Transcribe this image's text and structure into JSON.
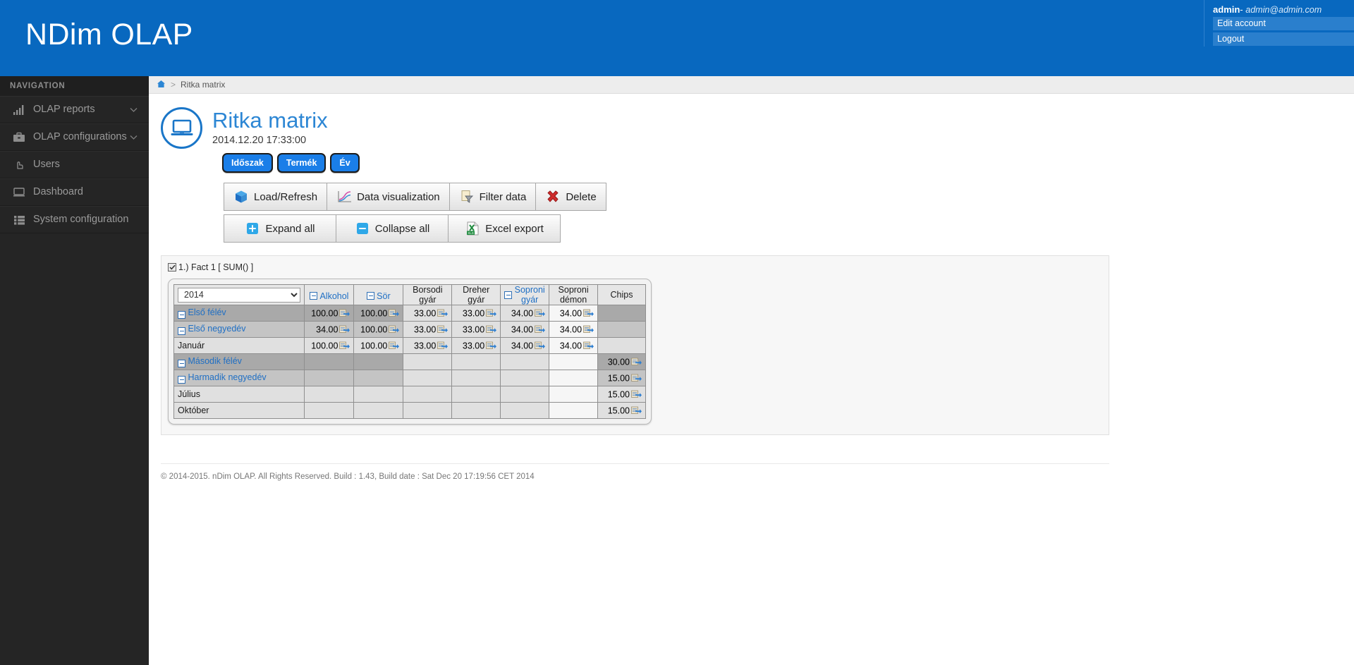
{
  "header": {
    "brand": "NDim OLAP",
    "account": {
      "user": "admin",
      "dash": "-",
      "email": "admin@admin.com",
      "menu": [
        {
          "label": "Edit account",
          "icon": "edit-account"
        },
        {
          "label": "Logout",
          "icon": "logout"
        }
      ]
    }
  },
  "sidebar": {
    "title": "NAVIGATION",
    "items": [
      {
        "label": "OLAP reports",
        "icon": "bar-chart-icon",
        "chevron": true
      },
      {
        "label": "OLAP configurations",
        "icon": "briefcase-icon",
        "chevron": true
      },
      {
        "label": "Users",
        "icon": "hand-pointer-icon",
        "chevron": false
      },
      {
        "label": "Dashboard",
        "icon": "monitor-icon",
        "chevron": false
      },
      {
        "label": "System configuration",
        "icon": "list-icon",
        "chevron": false
      }
    ]
  },
  "breadcrumb": {
    "home_icon": "home-icon",
    "separator": ">",
    "current": "Ritka matrix"
  },
  "page": {
    "icon": "monitor-circle-icon",
    "title": "Ritka matrix",
    "timestamp": "2014.12.20 17:33:00",
    "dimension_pills": [
      "Időszak",
      "Termék",
      "Év"
    ]
  },
  "toolbar": {
    "row1": [
      {
        "label": "Load/Refresh",
        "icon": "cube-icon"
      },
      {
        "label": "Data visualization",
        "icon": "line-chart-icon"
      },
      {
        "label": "Filter data",
        "icon": "funnel-icon"
      },
      {
        "label": "Delete",
        "icon": "red-x-icon"
      }
    ],
    "row2": [
      {
        "label": "Expand all",
        "icon": "plus-box-icon"
      },
      {
        "label": "Collapse all",
        "icon": "minus-box-icon"
      },
      {
        "label": "Excel export",
        "icon": "xls-icon"
      }
    ]
  },
  "result": {
    "fact_checkbox_checked": true,
    "fact_label": "1.) Fact 1 [ SUM() ]",
    "year_select": {
      "value": "2014",
      "options": [
        "2014"
      ]
    },
    "columns": [
      {
        "label": "Alkohol",
        "collapsible": true,
        "link": true,
        "style": "sel"
      },
      {
        "label": "Sör",
        "collapsible": true,
        "link": true,
        "style": "semi"
      },
      {
        "label": "Borsodi gyár",
        "collapsible": false,
        "link": false,
        "style": "lite"
      },
      {
        "label": "Dreher gyár",
        "collapsible": false,
        "link": false,
        "style": "lite"
      },
      {
        "label": "Soproni gyár",
        "collapsible": true,
        "link": true,
        "style": "lite"
      },
      {
        "label": "Soproni démon",
        "collapsible": false,
        "link": false,
        "style": "white"
      },
      {
        "label": "Chips",
        "collapsible": false,
        "link": false,
        "style": "sel"
      }
    ],
    "rows": [
      {
        "label": "Első félév",
        "collapsible": true,
        "link": true,
        "indent": 0,
        "style": "sel",
        "cells": [
          "100.00",
          "100.00",
          "33.00",
          "33.00",
          "34.00",
          "34.00",
          ""
        ]
      },
      {
        "label": "Első negyedév",
        "collapsible": true,
        "link": true,
        "indent": 1,
        "style": "semi",
        "cells": [
          "34.00",
          "100.00",
          "33.00",
          "33.00",
          "34.00",
          "34.00",
          ""
        ]
      },
      {
        "label": "Január",
        "collapsible": false,
        "link": false,
        "indent": 2,
        "style": "lite",
        "cells": [
          "100.00",
          "100.00",
          "33.00",
          "33.00",
          "34.00",
          "34.00",
          ""
        ]
      },
      {
        "label": "Második félév",
        "collapsible": true,
        "link": true,
        "indent": 0,
        "style": "sel",
        "cells": [
          "",
          "",
          "",
          "",
          "",
          "",
          "30.00"
        ]
      },
      {
        "label": "Harmadik negyedév",
        "collapsible": true,
        "link": true,
        "indent": 1,
        "style": "semi",
        "cells": [
          "",
          "",
          "",
          "",
          "",
          "",
          "15.00"
        ]
      },
      {
        "label": "Július",
        "collapsible": false,
        "link": false,
        "indent": 2,
        "style": "lite",
        "cells": [
          "",
          "",
          "",
          "",
          "",
          "",
          "15.00"
        ]
      },
      {
        "label": "Október",
        "collapsible": false,
        "link": false,
        "indent": 2,
        "style": "lite",
        "cells": [
          "",
          "",
          "",
          "",
          "",
          "",
          "15.00"
        ]
      }
    ]
  },
  "footer": {
    "text": "© 2014-2015. nDim OLAP. All Rights Reserved. Build : 1.43, Build date : Sat Dec 20 17:19:56 CET 2014"
  }
}
